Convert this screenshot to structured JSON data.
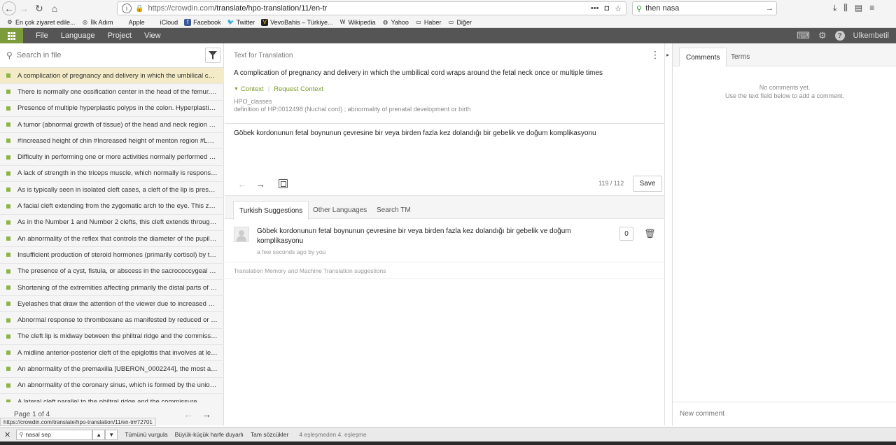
{
  "browser": {
    "url_domain": "https://crowdin.com",
    "url_path": "/translate/hpo-translation/11/en-tr",
    "url_more": "•••",
    "search_query": "then nasa",
    "bookmarks": [
      {
        "label": "En çok ziyaret edile...",
        "icon": "gear-icon"
      },
      {
        "label": "İlk Adım",
        "icon": "globe-icon"
      },
      {
        "label": "Apple",
        "icon": "apple-icon"
      },
      {
        "label": "iCloud",
        "icon": "apple-icon"
      },
      {
        "label": "Facebook",
        "icon": "facebook-icon"
      },
      {
        "label": "Twitter",
        "icon": "twitter-icon"
      },
      {
        "label": "VevoBahis – Türkiye...",
        "icon": "site-icon"
      },
      {
        "label": "Wikipedia",
        "icon": "wikipedia-icon"
      },
      {
        "label": "Yahoo",
        "icon": "yahoo-icon"
      },
      {
        "label": "Haber",
        "icon": "folder-icon"
      },
      {
        "label": "Diğer",
        "icon": "folder-icon"
      }
    ]
  },
  "app": {
    "menu": [
      "File",
      "Language",
      "Project",
      "View"
    ],
    "user": "Ulkembetil",
    "accent": "#7c9b3a"
  },
  "left": {
    "search_placeholder": "Search in file",
    "strings": [
      "A complication of pregnancy and delivery in which the umbilical cord ...",
      "There is normally one ossification center in the head of the femur. Th...",
      "Presence of multiple hyperplastic polyps in the colon. Hyperplastic p...",
      "A tumor (abnormal growth of tissue) of the head and neck region wit...",
      "#Increased height of chin #Increased height of menton region #Long...",
      "Difficulty in performing one or more activities normally performed ev...",
      "A lack of strength in the triceps muscle, which normally is responsible...",
      "As is typically seen in isolated cleft cases, a cleft of the lip is present. T...",
      "A facial cleft extending from the zygomatic arch to the eye. This zygo...",
      "As in the Number 1 and Number 2 clefts, this cleft extends through t...",
      "An abnormality of the reflex that controls the diameter of the pupil, i...",
      "Insufficient production of steroid hormones (primarily cortisol) by the...",
      "The presence of a cyst, fistula, or abscess in the sacrococcygeal regio...",
      "Shortening of the extremities affecting primarily the distal parts of th...",
      "Eyelashes that draw the attention of the viewer due to increased den...",
      "Abnormal response to thromboxane as manifested by reduced or lac...",
      "The cleft lip is midway between the philtral ridge and the commissur...",
      "A midline anterior-posterior cleft of the epiglottis that involves at leas...",
      "An abnormality of the premaxilla [UBERON_0002244], the most anter...",
      "An abnormality of the coronary sinus, which is formed by the union o...",
      "A lateral cleft parallel to the philtral ridge and the commissure..."
    ],
    "pager": "Page 1 of 4"
  },
  "center": {
    "source_header": "Text for Translation",
    "source_text": "A complication of pregnancy and delivery in which the umbilical cord wraps around the fetal neck once or multiple times",
    "context_label": "Context",
    "request_context_label": "Request Context",
    "context_file": "HPO_classes",
    "context_desc": "definition of HP:0012498 (Nuchal cord) ; abnormality of prenatal development or birth",
    "translation_text": "Göbek kordonunun fetal boynunun çevresine bir veya birden fazla kez dolandığı bir gebelik ve doğum komplikasyonu",
    "char_counter": "119 / 112",
    "save_label": "Save",
    "tabs": [
      "Turkish Suggestions",
      "Other Languages",
      "Search TM"
    ],
    "suggestion": {
      "text": "Göbek kordonunun fetal boynunun çevresine bir veya birden fazla kez dolandığı bir gebelik ve doğum komplikasyonu",
      "meta": "a few seconds ago by you",
      "votes": "0"
    },
    "tm_note": "Translation Memory and Machine Translation suggestions"
  },
  "right": {
    "tabs": [
      "Comments",
      "Terms"
    ],
    "no_comments_1": "No comments yet.",
    "no_comments_2": "Use the text field below to add a comment.",
    "new_comment_placeholder": "New comment"
  },
  "status_url": "https://crowdin.com/translate/hpo-translation/11/en-tr#72701",
  "find_bar": {
    "query": "nasal sep",
    "highlight_all": "Tümünü vurgula",
    "match_case": "Büyük-küçük harfe duyarlı",
    "whole_words": "Tam sözcükler",
    "result": "4 eşleşmeden 4. eşleşme"
  }
}
